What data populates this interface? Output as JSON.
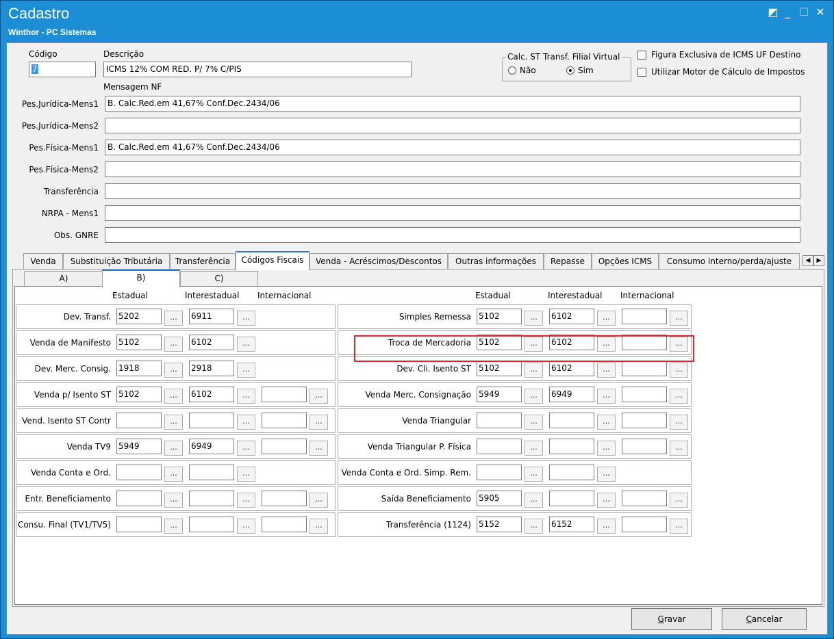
{
  "window": {
    "title": "Cadastro",
    "subtitle": "Winthor - PC Sistemas",
    "controls": {
      "restore": "◩",
      "minimize": "_",
      "maximize": "☐",
      "close": "✕"
    }
  },
  "header": {
    "codigo_label": "Código",
    "codigo_value": "7",
    "descricao_label": "Descrição",
    "descricao_value": "ICMS 12% COM RED. P/ 7% C/PIS",
    "calc_st_legend": "Calc. ST Transf. Filial Virtual",
    "calc_st_options": [
      "Não",
      "Sim"
    ],
    "calc_st_selected": "Sim",
    "check_figura": "Figura Exclusiva de ICMS UF Destino",
    "check_motor": "Utilizar Motor de Cálculo de Impostos",
    "mensagem_nf_label": "Mensagem NF"
  },
  "messages": [
    {
      "label": "Pes.Jurídica-Mens1",
      "value": "B. Calc.Red.em 41,67% Conf.Dec.2434/06"
    },
    {
      "label": "Pes.Jurídica-Mens2",
      "value": ""
    },
    {
      "label": "Pes.Física-Mens1",
      "value": "B. Calc.Red.em 41,67% Conf.Dec.2434/06"
    },
    {
      "label": "Pes.Física-Mens2",
      "value": ""
    },
    {
      "label": "Transferência",
      "value": ""
    },
    {
      "label": "NRPA - Mens1",
      "value": ""
    },
    {
      "label": "Obs. GNRE",
      "value": ""
    }
  ],
  "tabs": [
    "Venda",
    "Substituição Tributária",
    "Transferência",
    "Códigos Fiscais",
    "Venda - Acréscimos/Descontos",
    "Outras informações",
    "Repasse",
    "Opções ICMS",
    "Consumo interno/perda/ajuste"
  ],
  "active_tab": "Códigos Fiscais",
  "subtabs": [
    "A)",
    "B)",
    "C)"
  ],
  "active_subtab": "B)",
  "columns": [
    "Estadual",
    "Interestadual",
    "Internacional"
  ],
  "browse_label": "...",
  "left_rows": [
    {
      "label": "Dev. Transf.",
      "estadual": "5202",
      "interestadual": "6911",
      "internacional": null
    },
    {
      "label": "Venda de Manifesto",
      "estadual": "5102",
      "interestadual": "6102",
      "internacional": null
    },
    {
      "label": "Dev. Merc. Consig.",
      "estadual": "1918",
      "interestadual": "2918",
      "internacional": null
    },
    {
      "label": "Venda p/ Isento ST",
      "estadual": "5102",
      "interestadual": "6102",
      "internacional": ""
    },
    {
      "label": "Vend. Isento ST Contr",
      "estadual": "",
      "interestadual": "",
      "internacional": ""
    },
    {
      "label": "Venda TV9",
      "estadual": "5949",
      "interestadual": "6949",
      "internacional": ""
    },
    {
      "label": "Venda Conta e Ord.",
      "estadual": "",
      "interestadual": "",
      "internacional": null
    },
    {
      "label": "Entr. Beneficiamento",
      "estadual": "",
      "interestadual": "",
      "internacional": ""
    },
    {
      "label": "Consu. Final (TV1/TV5)",
      "estadual": "",
      "interestadual": "",
      "internacional": ""
    }
  ],
  "right_rows": [
    {
      "label": "Simples Remessa",
      "estadual": "5102",
      "interestadual": "6102",
      "internacional": ""
    },
    {
      "label": "Troca de Mercadoria",
      "estadual": "5102",
      "interestadual": "6102",
      "internacional": ""
    },
    {
      "label": "Dev. Cli. Isento ST",
      "estadual": "5102",
      "interestadual": "6102",
      "internacional": ""
    },
    {
      "label": "Venda Merc. Consignação",
      "estadual": "5949",
      "interestadual": "6949",
      "internacional": ""
    },
    {
      "label": "Venda Triangular",
      "estadual": "",
      "interestadual": "",
      "internacional": ""
    },
    {
      "label": "Venda Triangular P. Física",
      "estadual": "",
      "interestadual": "",
      "internacional": ""
    },
    {
      "label": "Venda Conta e Ord. Simp. Rem.",
      "estadual": "",
      "interestadual": "",
      "internacional": null
    },
    {
      "label": "Saída Beneficiamento",
      "estadual": "5905",
      "interestadual": "",
      "internacional": ""
    },
    {
      "label": "Transferência (1124)",
      "estadual": "5152",
      "interestadual": "6152",
      "internacional": ""
    }
  ],
  "buttons": {
    "gravar_mnemonic": "G",
    "gravar_rest": "ravar",
    "cancelar_mnemonic": "C",
    "cancelar_rest": "ancelar"
  },
  "colors": {
    "titlebar": "#1c8ed6",
    "highlight": "#e0262b",
    "active_tab_accent": "#2d7ad6"
  }
}
